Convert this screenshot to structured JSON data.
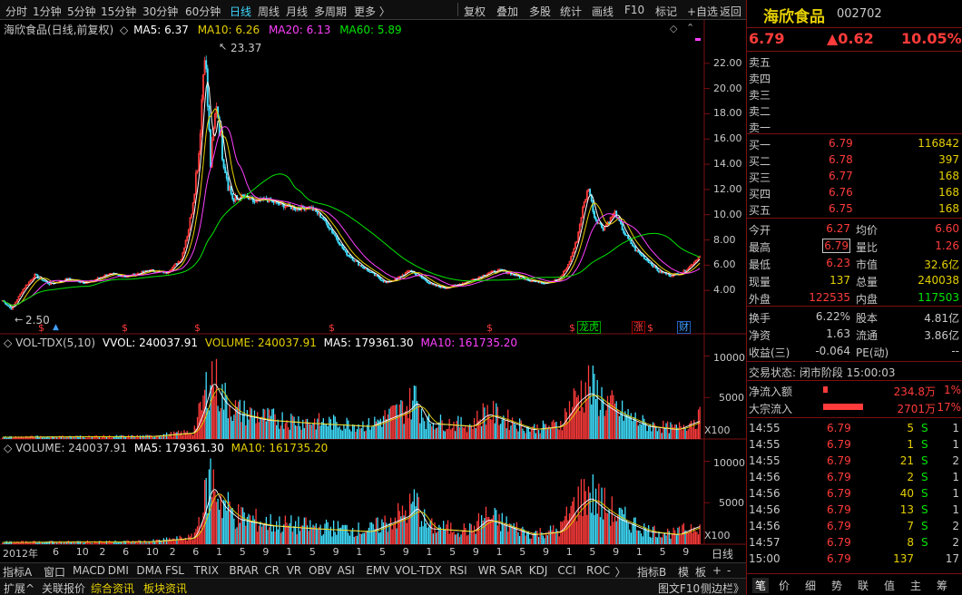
{
  "toolbar": {
    "periods": [
      "分时",
      "1分钟",
      "5分钟",
      "15分钟",
      "30分钟",
      "60分钟",
      "日线",
      "周线",
      "月线",
      "多周期",
      "更多 〉"
    ],
    "actions": [
      "复权",
      "叠加",
      "多股",
      "统计",
      "画线",
      "F10",
      "标记",
      "+自选",
      "返回"
    ]
  },
  "chart_header": {
    "name": "海欣食品(日线,前复权)",
    "ma5": "MA5: 6.37",
    "ma10": "MA10: 6.26",
    "ma20": "MA20: 6.13",
    "ma60": "MA60: 5.89"
  },
  "price_annotations": {
    "high": "23.37",
    "low": "2.50"
  },
  "price_axis": [
    "22.00",
    "20.00",
    "18.00",
    "16.00",
    "14.00",
    "12.00",
    "10.00",
    "8.00",
    "6.00",
    "4.00"
  ],
  "vol_tdx_header": {
    "label": "VOL-TDX(5,10)",
    "vvol": "VVOL: 240037.91",
    "volume": "VOLUME: 240037.91",
    "ma5": "MA5: 179361.30",
    "ma10": "MA10: 161735.20"
  },
  "volume_header": {
    "volume": "VOLUME: 240037.91",
    "ma5": "MA5: 179361.30",
    "ma10": "MA10: 161735.20"
  },
  "vol_axis": [
    "10000",
    "5000"
  ],
  "vol_unit": "X100",
  "markers": {
    "s": "$",
    "longhu": "龙虎",
    "zhang": "涨",
    "cai": "财"
  },
  "time_axis": {
    "year": "2012年",
    "months": [
      "6",
      "10",
      "2",
      "6",
      "10",
      "2",
      "6",
      "1",
      "5",
      "9",
      "1",
      "5",
      "9",
      "1",
      "5",
      "9",
      "1",
      "5",
      "9",
      "1",
      "5",
      "9",
      "1",
      "5",
      "9",
      "1",
      "5",
      "9"
    ],
    "period_label": "日线"
  },
  "indicator_tabs": [
    "指标A",
    "窗口",
    "MACD",
    "DMI",
    "DMA",
    "FSL",
    "TRIX",
    "BRAR",
    "CR",
    "VR",
    "OBV",
    "ASI",
    "EMV",
    "VOL-TDX",
    "RSI",
    "WR",
    "SAR",
    "KDJ",
    "CCI",
    "ROC",
    "〉"
  ],
  "indicator_tabs_right": [
    "指标B",
    "模",
    "板",
    "+",
    "-"
  ],
  "status_tabs": [
    "扩展^",
    "关联报价",
    "综合资讯",
    "板块资讯"
  ],
  "status_right": [
    "图文F10",
    "侧边栏》"
  ],
  "stock": {
    "name": "海欣食品",
    "code": "002702",
    "price": "6.79",
    "change": "▲0.62",
    "pct": "10.05%"
  },
  "asks": [
    {
      "label": "卖五"
    },
    {
      "label": "卖四"
    },
    {
      "label": "卖三"
    },
    {
      "label": "卖二"
    },
    {
      "label": "卖一"
    }
  ],
  "bids": [
    {
      "label": "买一",
      "price": "6.79",
      "vol": "116842"
    },
    {
      "label": "买二",
      "price": "6.78",
      "vol": "397"
    },
    {
      "label": "买三",
      "price": "6.77",
      "vol": "168"
    },
    {
      "label": "买四",
      "price": "6.76",
      "vol": "168"
    },
    {
      "label": "买五",
      "price": "6.75",
      "vol": "168"
    }
  ],
  "stats": [
    {
      "l1": "今开",
      "v1": "6.27",
      "l2": "均价",
      "v2": "6.60"
    },
    {
      "l1": "最高",
      "v1": "6.79",
      "l2": "量比",
      "v2": "1.26"
    },
    {
      "l1": "最低",
      "v1": "6.23",
      "l2": "市值",
      "v2": "32.6亿"
    },
    {
      "l1": "现量",
      "v1": "137",
      "l2": "总量",
      "v2": "240038"
    },
    {
      "l1": "外盘",
      "v1": "122535",
      "l2": "内盘",
      "v2": "117503"
    }
  ],
  "stats2": [
    {
      "l1": "换手",
      "v1": "6.22%",
      "l2": "股本",
      "v2": "4.81亿"
    },
    {
      "l1": "净资",
      "v1": "1.63",
      "l2": "流通",
      "v2": "3.86亿"
    },
    {
      "l1": "收益(三)",
      "v1": "-0.064",
      "l2": "PE(动)",
      "v2": "--"
    }
  ],
  "trade_status": "交易状态: 闭市阶段 15:00:03",
  "flows": [
    {
      "label": "净流入额",
      "value": "234.8万",
      "pct": "1%",
      "bar": 0.02
    },
    {
      "label": "大宗流入",
      "value": "2701万",
      "pct": "17%",
      "bar": 0.17
    }
  ],
  "ticks": [
    {
      "time": "14:55",
      "price": "6.79",
      "vol": "5",
      "side": "S",
      "n": "1"
    },
    {
      "time": "14:55",
      "price": "6.79",
      "vol": "1",
      "side": "S",
      "n": "1"
    },
    {
      "time": "14:55",
      "price": "6.79",
      "vol": "21",
      "side": "S",
      "n": "2"
    },
    {
      "time": "14:56",
      "price": "6.79",
      "vol": "2",
      "side": "S",
      "n": "1"
    },
    {
      "time": "14:56",
      "price": "6.79",
      "vol": "40",
      "side": "S",
      "n": "1"
    },
    {
      "time": "14:56",
      "price": "6.79",
      "vol": "13",
      "side": "S",
      "n": "1"
    },
    {
      "time": "14:56",
      "price": "6.79",
      "vol": "7",
      "side": "S",
      "n": "2"
    },
    {
      "time": "14:57",
      "price": "6.79",
      "vol": "8",
      "side": "S",
      "n": "2"
    },
    {
      "time": "15:00",
      "price": "6.79",
      "vol": "137",
      "side": "",
      "n": "17"
    }
  ],
  "bottom_tabs": [
    "笔",
    "价",
    "细",
    "势",
    "联",
    "值",
    "主",
    "筹"
  ],
  "chart_data": {
    "type": "candlestick",
    "y_range": [
      2.0,
      24.0
    ],
    "ma_series_names": [
      "MA5",
      "MA10",
      "MA20",
      "MA60"
    ],
    "price_anchor_points": [
      [
        0,
        3.2
      ],
      [
        6,
        2.5
      ],
      [
        14,
        4.1
      ],
      [
        22,
        5.2
      ],
      [
        32,
        4.5
      ],
      [
        44,
        4.9
      ],
      [
        58,
        4.6
      ],
      [
        72,
        5.3
      ],
      [
        86,
        5.1
      ],
      [
        100,
        5.6
      ],
      [
        112,
        5.4
      ],
      [
        122,
        6.5
      ],
      [
        128,
        9.5
      ],
      [
        134,
        15.0
      ],
      [
        138,
        23.37
      ],
      [
        142,
        14.0
      ],
      [
        146,
        19.0
      ],
      [
        150,
        15.0
      ],
      [
        154,
        12.5
      ],
      [
        158,
        11.0
      ],
      [
        164,
        11.5
      ],
      [
        172,
        11.0
      ],
      [
        180,
        11.2
      ],
      [
        190,
        10.8
      ],
      [
        200,
        10.5
      ],
      [
        210,
        10.6
      ],
      [
        218,
        9.8
      ],
      [
        226,
        8.5
      ],
      [
        234,
        7.0
      ],
      [
        244,
        6.0
      ],
      [
        254,
        5.2
      ],
      [
        262,
        4.6
      ],
      [
        270,
        5.0
      ],
      [
        278,
        5.6
      ],
      [
        286,
        5.0
      ],
      [
        294,
        4.4
      ],
      [
        302,
        4.2
      ],
      [
        312,
        4.5
      ],
      [
        322,
        4.9
      ],
      [
        332,
        5.4
      ],
      [
        340,
        5.6
      ],
      [
        350,
        5.2
      ],
      [
        360,
        4.8
      ],
      [
        370,
        4.6
      ],
      [
        380,
        4.9
      ],
      [
        386,
        6.0
      ],
      [
        392,
        8.0
      ],
      [
        396,
        10.5
      ],
      [
        400,
        12.2
      ],
      [
        404,
        9.8
      ],
      [
        410,
        8.9
      ],
      [
        418,
        10.2
      ],
      [
        424,
        8.6
      ],
      [
        432,
        7.2
      ],
      [
        440,
        6.4
      ],
      [
        448,
        5.5
      ],
      [
        456,
        5.2
      ],
      [
        464,
        5.4
      ],
      [
        470,
        6.0
      ],
      [
        476,
        6.79
      ]
    ],
    "volume_scale_max": 10500,
    "volume_profile": [
      [
        0,
        300
      ],
      [
        100,
        400
      ],
      [
        130,
        1000
      ],
      [
        136,
        4500
      ],
      [
        142,
        9500
      ],
      [
        150,
        6000
      ],
      [
        160,
        4000
      ],
      [
        180,
        3000
      ],
      [
        210,
        2500
      ],
      [
        250,
        2000
      ],
      [
        276,
        4500
      ],
      [
        282,
        6000
      ],
      [
        290,
        2500
      ],
      [
        320,
        2000
      ],
      [
        330,
        4000
      ],
      [
        360,
        1500
      ],
      [
        380,
        2000
      ],
      [
        392,
        6000
      ],
      [
        400,
        7500
      ],
      [
        410,
        5500
      ],
      [
        420,
        4000
      ],
      [
        440,
        2000
      ],
      [
        460,
        1500
      ],
      [
        470,
        2500
      ],
      [
        476,
        3000
      ]
    ]
  }
}
